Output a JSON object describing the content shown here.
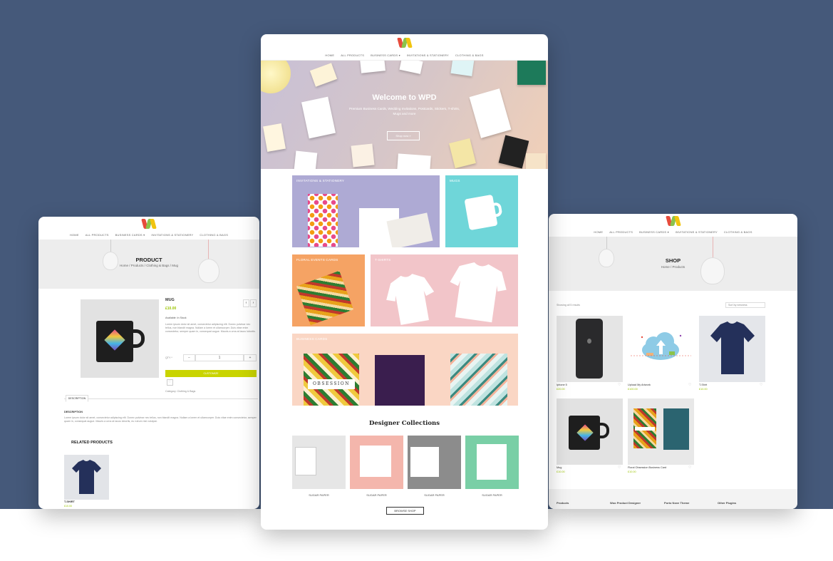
{
  "center": {
    "nav": [
      "HOME",
      "ALL PRODUCTS",
      "BUSINESS CARDS ▾",
      "INVITATIONS & STATIONERY",
      "CLOTHING & BAGS"
    ],
    "hero": {
      "title": "Welcome to WPD",
      "subtitle": "Premium Business Cards, Wedding Invitations, Postcards, Stickers, T-shirts, Mugs and more",
      "button": "Shop now »"
    },
    "categories": [
      "INVITATIONS & STATIONERY",
      "MUGS",
      "FLORAL EVENTS CARDS",
      "T-SHIRTS",
      "BUSINESS CARDS"
    ],
    "obsession_text": "OBSESSION",
    "designer_title": "Designer Collections",
    "collections": [
      "SUGAR PAPER",
      "SUGAR PAPER",
      "SUGAR PAPER",
      "SUGAR PAPER"
    ],
    "browse_button": "BROWSE SHOP"
  },
  "left": {
    "nav": [
      "HOME",
      "ALL PRODUCTS",
      "BUSINESS CARDS ▾",
      "INVITATIONS & STATIONERY",
      "CLOTHING & BAGS"
    ],
    "title": "PRODUCT",
    "breadcrumb": "Home / Products / Clothing & Bags / Mug",
    "product_name": "MUG",
    "price": "£10.00",
    "availability": "Available: In Stock",
    "description_short": "Lorem ipsum dolor sit amet, consectetur adipiscing elit. Donec pulvinar nec tellus, non blandit magna. Nullam a lorem et ullamcorper. Duis vitae enim consectetur, semper quam in, consequat augue. Mauris a urna at lacus lobortis.",
    "qty_label": "QTY *",
    "qty_minus": "−",
    "qty_value": "1",
    "qty_plus": "+",
    "customize_button": "CUSTOMIZE",
    "category": "Category: Clothing & Bags",
    "tab_description": "DESCRIPTION",
    "description_heading": "DESCRIPTION",
    "description_long": "Lorem ipsum dolor sit amet, consectetur adipiscing elit. Donec pulvinar nec tellus, non blandit magna. Nullam a lorem et ullamcorper. Duis vitae enim consectetur, semper quam in, consequat augue. Mauris a urna at lacus lobortis, eu rutrum nisl volutpat.",
    "related_title": "RELATED PRODUCTS",
    "related_name": "T-SHIRT",
    "related_price": "£10.00"
  },
  "right": {
    "nav": [
      "HOME",
      "ALL PRODUCTS",
      "BUSINESS CARDS ▾",
      "INVITATIONS & STATIONERY",
      "CLOTHING & BAGS"
    ],
    "title": "SHOP",
    "breadcrumb": "Home / Products",
    "results": "Showing all 5 results",
    "sort": "Sort by newness",
    "products": [
      {
        "name": "Iphone 5",
        "price": "£20.00"
      },
      {
        "name": "Upload My Artwork",
        "price": "£100.00"
      },
      {
        "name": "T-Shirt",
        "price": "£10.00"
      },
      {
        "name": "Mug",
        "price": "£10.00"
      },
      {
        "name": "Floral Obsession Business Card",
        "price": "£10.00"
      }
    ],
    "footer": [
      "Products",
      "Woo Product Designer",
      "Porto Nove Theme",
      "Other Plugins"
    ]
  }
}
